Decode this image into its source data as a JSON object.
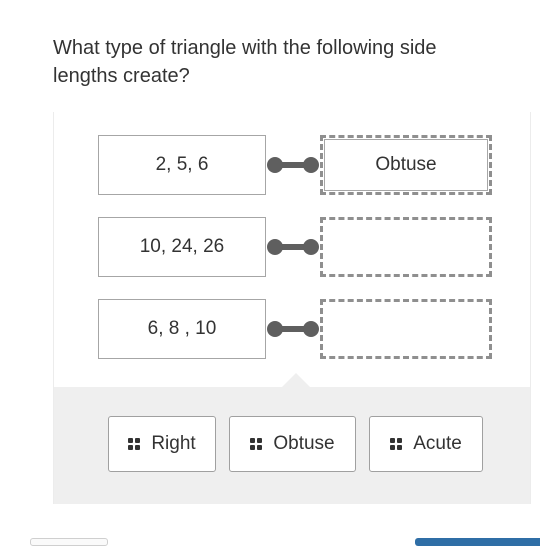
{
  "question": {
    "text": "What type of triangle with the following side lengths create?"
  },
  "matches": [
    {
      "premise": "2, 5, 6",
      "answer": "Obtuse"
    },
    {
      "premise": "10, 24, 26",
      "answer": ""
    },
    {
      "premise": "6, 8 , 10",
      "answer": ""
    }
  ],
  "answer_bank": {
    "options": [
      "Right",
      "Obtuse",
      "Acute"
    ]
  },
  "colors": {
    "connector": "#5f5f5f",
    "bank_background": "#efefef",
    "primary_button": "#2f6ea6"
  }
}
